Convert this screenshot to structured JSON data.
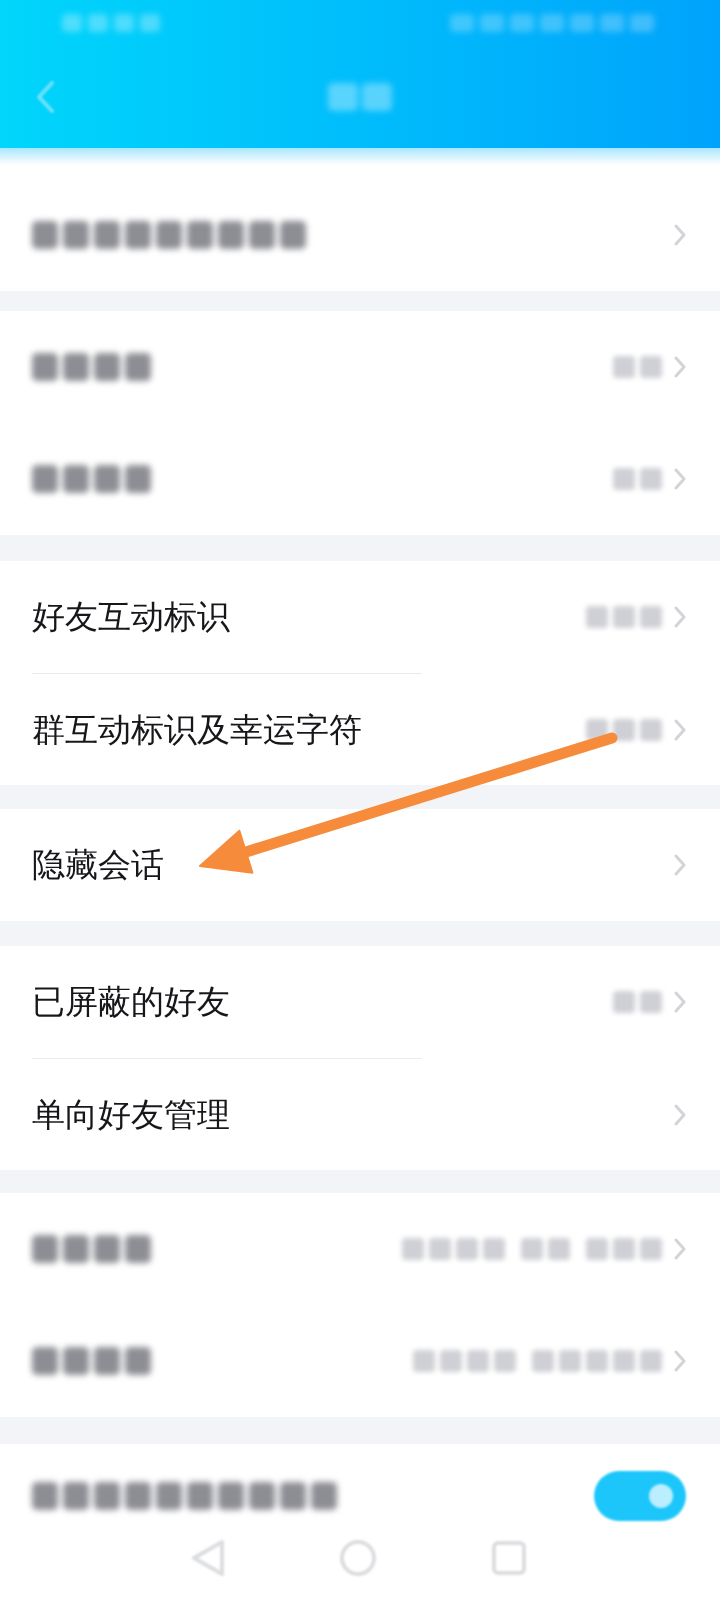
{
  "sections": [
    {
      "rows": [
        {
          "kind": "blurred",
          "trailing": {
            "kind": "chevron"
          }
        }
      ]
    },
    {
      "rows": [
        {
          "kind": "blurred",
          "trailing": {
            "kind": "blurred-value"
          }
        },
        {
          "kind": "blurred",
          "trailing": {
            "kind": "blurred-value"
          }
        }
      ]
    },
    {
      "rows": [
        {
          "kind": "text",
          "label": "好友互动标识",
          "trailing": {
            "kind": "blurred-value"
          }
        },
        {
          "kind": "text",
          "label": "群互动标识及幸运字符",
          "trailing": {
            "kind": "blurred-value"
          }
        }
      ]
    },
    {
      "rows": [
        {
          "kind": "text",
          "label": "隐藏会话",
          "trailing": {
            "kind": "chevron"
          }
        }
      ]
    },
    {
      "rows": [
        {
          "kind": "text",
          "label": "已屏蔽的好友",
          "trailing": {
            "kind": "blurred-value"
          }
        },
        {
          "kind": "text",
          "label": "单向好友管理",
          "trailing": {
            "kind": "chevron"
          }
        }
      ]
    },
    {
      "rows": [
        {
          "kind": "blurred",
          "trailing": {
            "kind": "blurred-value"
          }
        },
        {
          "kind": "blurred",
          "trailing": {
            "kind": "blurred-value"
          }
        }
      ]
    },
    {
      "rows": [
        {
          "kind": "blurred",
          "trailing": {
            "kind": "toggle",
            "on": true
          }
        }
      ]
    }
  ],
  "annotations": [
    {
      "kind": "arrow"
    }
  ],
  "nav_bar": {
    "buttons": [
      {
        "kind": "back"
      },
      {
        "kind": "home"
      },
      {
        "kind": "recents"
      }
    ]
  }
}
